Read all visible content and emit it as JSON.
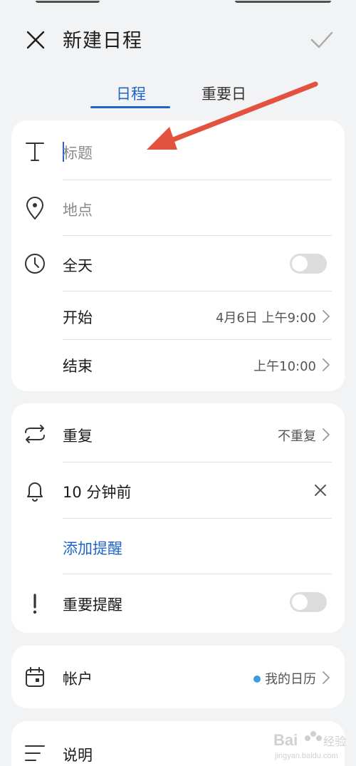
{
  "header": {
    "title": "新建日程",
    "close_icon": "close-icon",
    "confirm_icon": "check-icon"
  },
  "tabs": [
    {
      "label": "日程",
      "active": true
    },
    {
      "label": "重要日",
      "active": false
    }
  ],
  "event": {
    "title_placeholder": "标题",
    "location_placeholder": "地点",
    "all_day_label": "全天",
    "all_day_on": false,
    "start_label": "开始",
    "start_value": "4月6日 上午9:00",
    "end_label": "结束",
    "end_value": "上午10:00"
  },
  "reminders": {
    "repeat_label": "重复",
    "repeat_value": "不重复",
    "reminder_label": "10 分钟前",
    "add_reminder": "添加提醒",
    "important_label": "重要提醒",
    "important_on": false
  },
  "account": {
    "label": "帐户",
    "value": "我的日历",
    "dot_color": "#3b9ce2"
  },
  "notes": {
    "label": "说明"
  },
  "colors": {
    "accent": "#1f65c8",
    "annotation_arrow": "#e2523f",
    "background": "#f1f3f5"
  }
}
